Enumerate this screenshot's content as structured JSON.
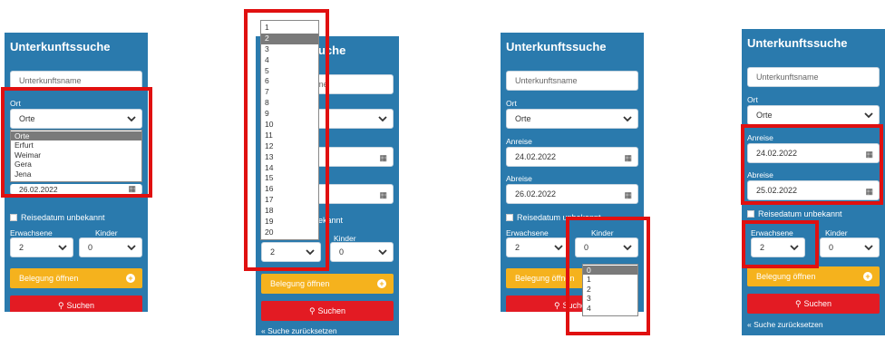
{
  "title": "Unterkunftssuche",
  "name_placeholder": "Unterkunftsname",
  "ort_label": "Ort",
  "ort_value": "Orte",
  "ort_options": [
    "Orte",
    "Erfurt",
    "Weimar",
    "Gera",
    "Jena"
  ],
  "anreise_label": "Anreise",
  "abreise_label": "Abreise",
  "panel3_anreise": "24.02.2022",
  "panel3_abreise": "26.02.2022",
  "panel4_anreise": "24.02.2022",
  "panel4_abreise": "25.02.2022",
  "panel1_partial_date": "26.02.2022",
  "reisedatum_label": "Reisedatum unbekannt",
  "erwachsene_label": "Erwachsene",
  "kinder_label": "Kinder",
  "erwachsene_value": "2",
  "kinder_value": "0",
  "belegung_label": "Belegung öffnen",
  "suchen_label": "Suchen",
  "reset_label": "« Suche zurücksetzen",
  "adults_options": [
    "1",
    "2",
    "3",
    "4",
    "5",
    "6",
    "7",
    "8",
    "9",
    "10",
    "11",
    "12",
    "13",
    "14",
    "15",
    "16",
    "17",
    "18",
    "19",
    "20"
  ],
  "kids_options": [
    "0",
    "1",
    "2",
    "3",
    "4"
  ],
  "colors": {
    "panel": "#2a7aad",
    "yellow": "#f5b21d",
    "red": "#e31b23",
    "highlight": "#e01010"
  }
}
